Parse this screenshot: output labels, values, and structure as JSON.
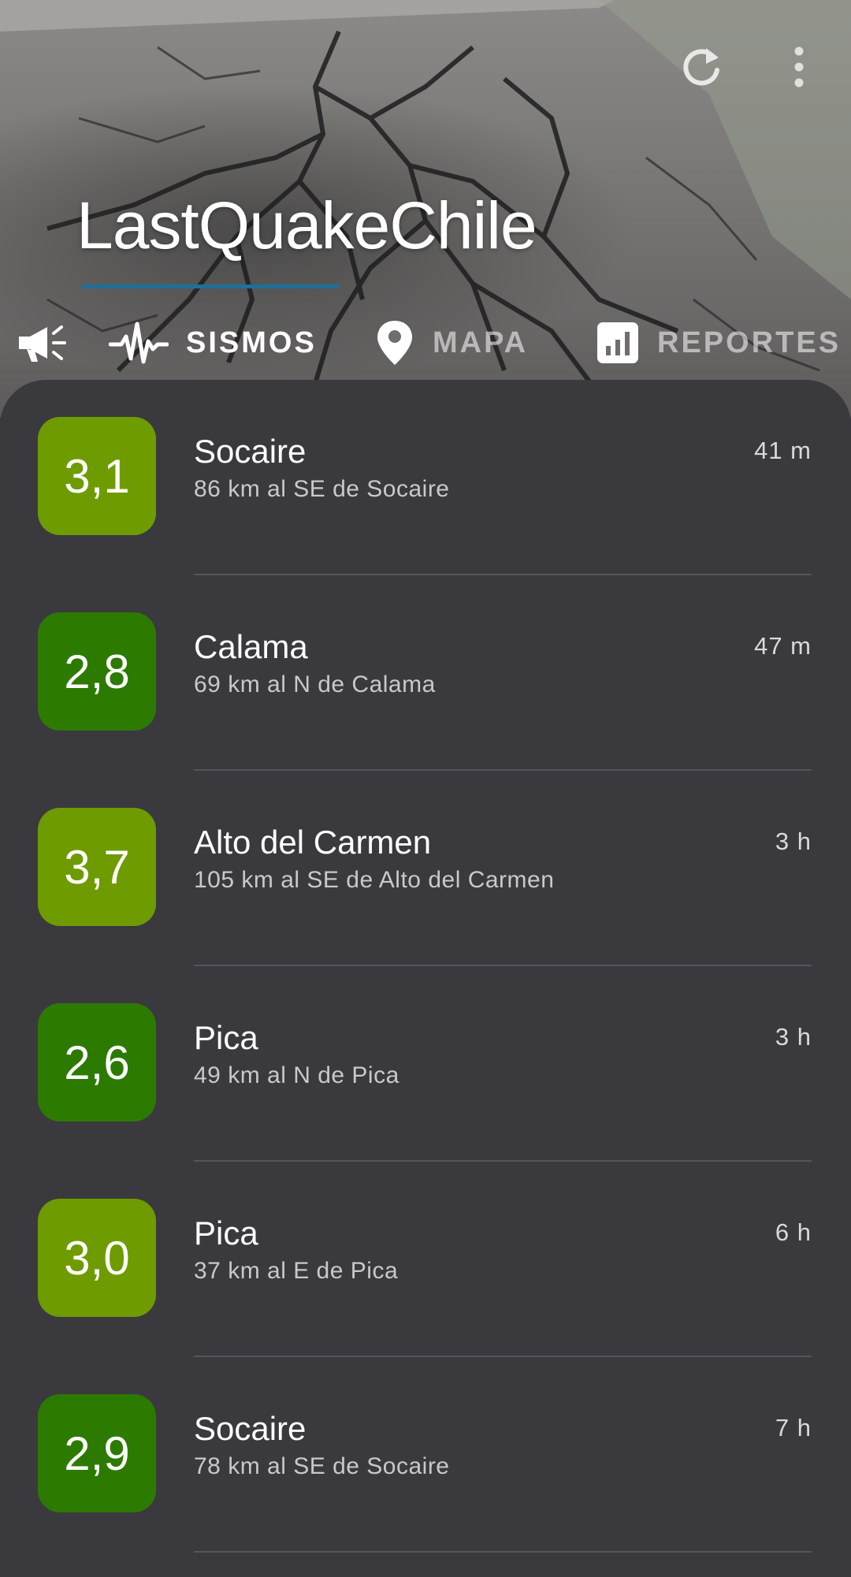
{
  "app": {
    "title": "LastQuakeChile"
  },
  "header_actions": [
    {
      "name": "refresh-icon"
    },
    {
      "name": "more-vert-icon"
    }
  ],
  "tabs": [
    {
      "icon": "megaphone-icon",
      "label": ""
    },
    {
      "icon": "seismograph-icon",
      "label": "SISMOS",
      "active": true
    },
    {
      "icon": "map-pin-icon",
      "label": "MAPA",
      "active": false
    },
    {
      "icon": "bar-chart-icon",
      "label": "REPORTES",
      "active": false
    }
  ],
  "colors": {
    "badge_light": "#6e9b00",
    "badge_dark": "#2d7a00",
    "tab_indicator": "#1f6f9a",
    "background": "#3a393e"
  },
  "quakes": [
    {
      "magnitude": "3,1",
      "place": "Socaire",
      "detail": "86 km al SE de Socaire",
      "time": "41 m",
      "color": "#6e9b00"
    },
    {
      "magnitude": "2,8",
      "place": "Calama",
      "detail": "69 km al N de Calama",
      "time": "47 m",
      "color": "#2d7a00"
    },
    {
      "magnitude": "3,7",
      "place": "Alto del Carmen",
      "detail": "105 km al SE de Alto del Carmen",
      "time": "3 h",
      "color": "#6e9b00"
    },
    {
      "magnitude": "2,6",
      "place": "Pica",
      "detail": "49 km al N de Pica",
      "time": "3 h",
      "color": "#2d7a00"
    },
    {
      "magnitude": "3,0",
      "place": "Pica",
      "detail": "37 km al E de Pica",
      "time": "6 h",
      "color": "#6e9b00"
    },
    {
      "magnitude": "2,9",
      "place": "Socaire",
      "detail": "78 km al SE de Socaire",
      "time": "7 h",
      "color": "#2d7a00"
    }
  ]
}
